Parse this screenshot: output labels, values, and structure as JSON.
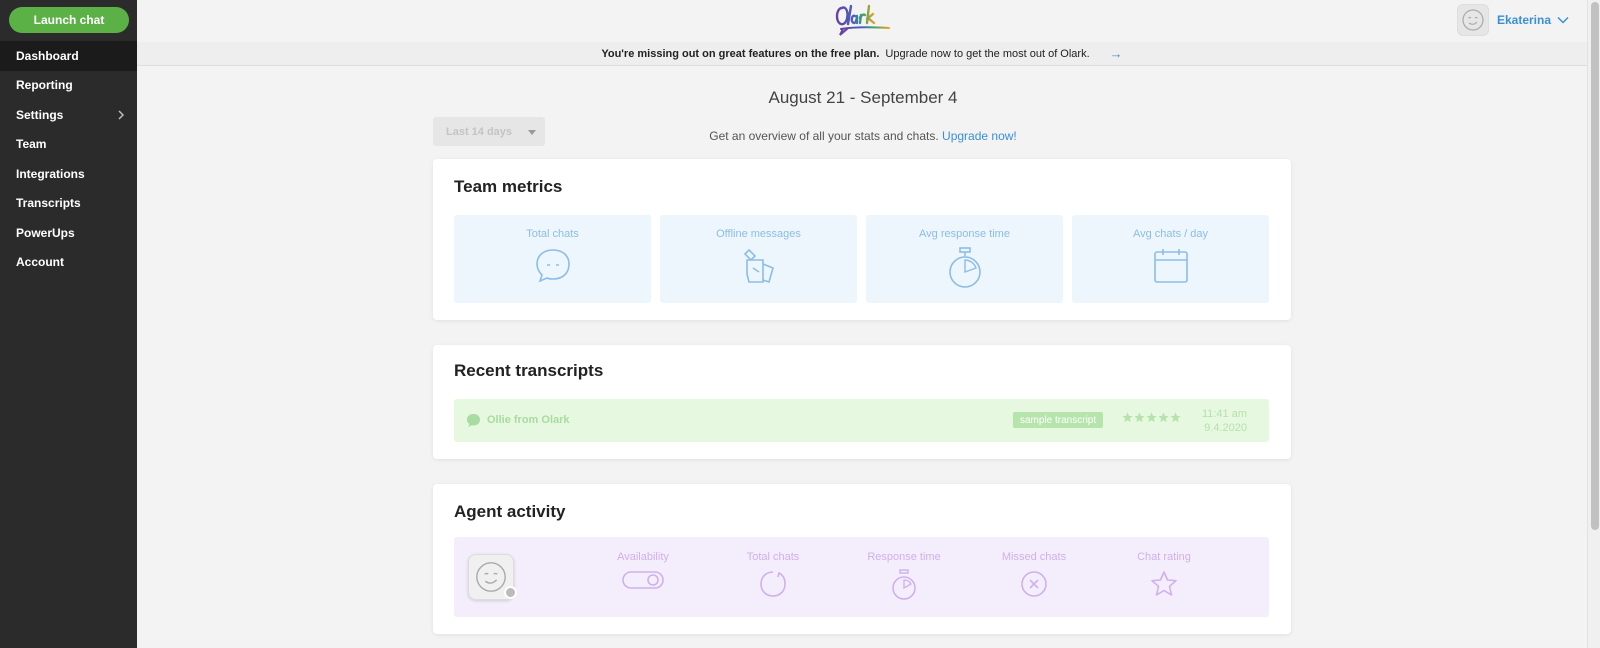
{
  "sidebar": {
    "launch_label": "Launch chat",
    "items": [
      {
        "label": "Dashboard"
      },
      {
        "label": "Reporting"
      },
      {
        "label": "Settings"
      },
      {
        "label": "Team"
      },
      {
        "label": "Integrations"
      },
      {
        "label": "Transcripts"
      },
      {
        "label": "PowerUps"
      },
      {
        "label": "Account"
      }
    ]
  },
  "header": {
    "user_name": "Ekaterina"
  },
  "banner": {
    "bold": "You're missing out on great features on the free plan.",
    "text": "Upgrade now to get the most out of Olark.",
    "arrow": "→"
  },
  "main": {
    "date_range": "August 21 - September 4",
    "range_select": "Last 14 days",
    "overview_text": "Get an overview of all your stats and chats.",
    "overview_link": "Upgrade now!"
  },
  "team_metrics": {
    "title": "Team metrics",
    "items": [
      {
        "label": "Total chats",
        "icon": "chat-bubble-icon"
      },
      {
        "label": "Offline messages",
        "icon": "offline-message-icon"
      },
      {
        "label": "Avg response time",
        "icon": "stopwatch-icon"
      },
      {
        "label": "Avg chats / day",
        "icon": "calendar-icon"
      }
    ]
  },
  "recent_transcripts": {
    "title": "Recent transcripts",
    "row": {
      "name": "Ollie from Olark",
      "badge": "sample transcript",
      "rating": 5,
      "time": "11:41 am",
      "date": "9.4.2020"
    }
  },
  "agent_activity": {
    "title": "Agent activity",
    "columns": [
      {
        "label": "Availability",
        "icon": "toggle-icon"
      },
      {
        "label": "Total chats",
        "icon": "chat-bubble-icon"
      },
      {
        "label": "Response time",
        "icon": "stopwatch-icon"
      },
      {
        "label": "Missed chats",
        "icon": "missed-chat-icon"
      },
      {
        "label": "Chat rating",
        "icon": "star-icon"
      }
    ]
  },
  "colors": {
    "sidebar": "#2b2b2b",
    "launch": "#5cb146",
    "link": "#3b8fd6"
  }
}
